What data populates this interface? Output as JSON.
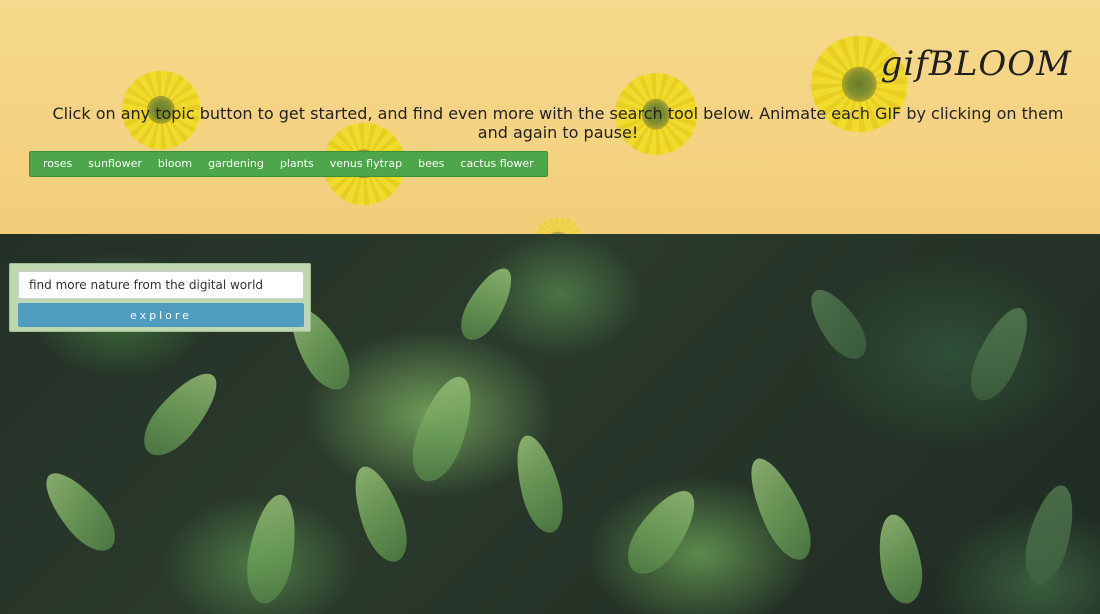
{
  "header": {
    "app_title": "gifBLOOM",
    "instructions": "Click on any topic button to get started, and find even more with the search tool below. Animate each GIF by clicking on them and again to pause!"
  },
  "topics": [
    "roses",
    "sunflower",
    "bloom",
    "gardening",
    "plants",
    "venus flytrap",
    "bees",
    "cactus flower"
  ],
  "search": {
    "placeholder": "find more nature from the digital world",
    "button_label": "explore"
  },
  "colors": {
    "header_background": "#f4d382",
    "topic_bar": "#4ea64a",
    "search_panel": "#bfd7b0",
    "explore_button": "#4e9cbf"
  }
}
